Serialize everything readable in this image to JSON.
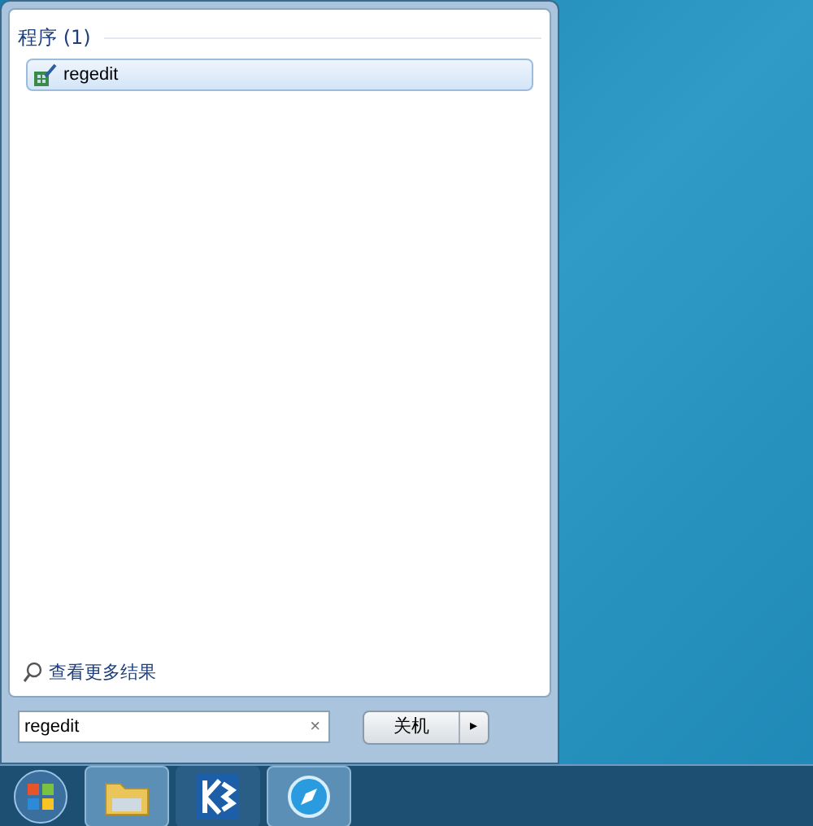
{
  "results": {
    "heading": "程序 (1)",
    "items": [
      {
        "label": "regedit",
        "selected": true
      }
    ]
  },
  "more_results": "查看更多结果",
  "search": {
    "value": "regedit",
    "clear": "×"
  },
  "shutdown": {
    "label": "关机",
    "arrow": "▸"
  },
  "taskbar": {
    "items": [
      {
        "kind": "start"
      },
      {
        "kind": "folder"
      },
      {
        "kind": "k-app"
      },
      {
        "kind": "compass"
      }
    ]
  }
}
